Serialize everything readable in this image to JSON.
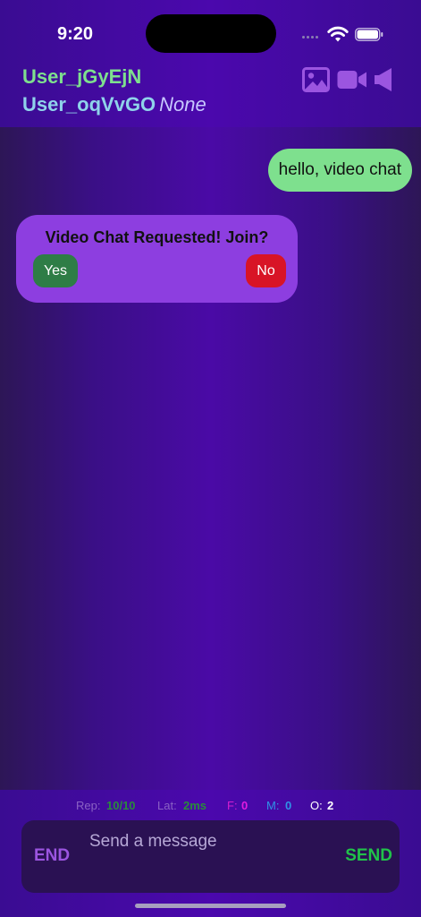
{
  "status_bar": {
    "time": "9:20"
  },
  "header": {
    "user_primary": "User_jGyEjN",
    "user_secondary": "User_oqVvGO",
    "user_secondary_status": "None",
    "icons": [
      "image-icon",
      "video-camera-icon",
      "speaker-icon"
    ],
    "icon_color": "#9b55e0"
  },
  "messages": [
    {
      "direction": "outgoing",
      "text": "hello, video chat",
      "color": "#7ee08e"
    }
  ],
  "video_request": {
    "title": "Video Chat Requested! Join?",
    "yes_label": "Yes",
    "no_label": "No",
    "card_color": "#8d3ee0",
    "yes_color": "#2e7d46",
    "no_color": "#d81426"
  },
  "stats": {
    "rep_label": "Rep:",
    "rep_value": "10/10",
    "lat_label": "Lat:",
    "lat_value": "2ms",
    "f_label": "F:",
    "f_value": "0",
    "m_label": "M:",
    "m_value": "0",
    "o_label": "O:",
    "o_value": "2"
  },
  "composer": {
    "end_label": "END",
    "placeholder": "Send a message",
    "value": "",
    "send_label": "SEND"
  }
}
